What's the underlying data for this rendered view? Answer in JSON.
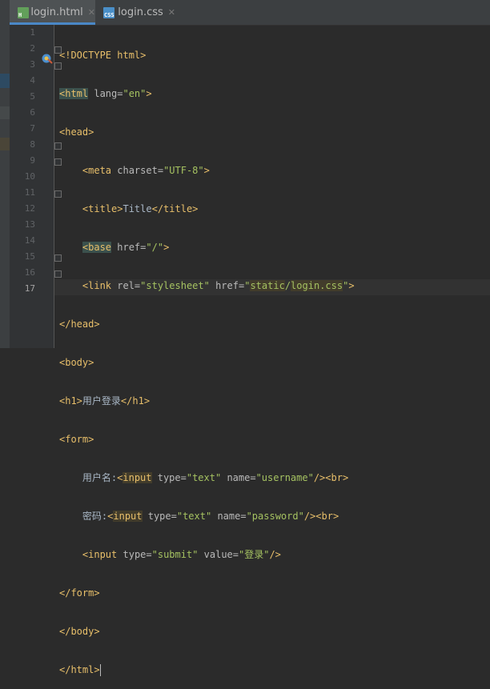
{
  "tabs": [
    {
      "label": "login.html",
      "icon": "html-file-icon",
      "icon_text": "H",
      "active": true
    },
    {
      "label": "login.css",
      "icon": "css-file-icon",
      "icon_text": "CSS",
      "active": false
    }
  ],
  "line_numbers": [
    "1",
    "2",
    "3",
    "4",
    "5",
    "6",
    "7",
    "8",
    "9",
    "10",
    "11",
    "12",
    "13",
    "14",
    "15",
    "16",
    "17"
  ],
  "current_line": "17",
  "code": {
    "l1": {
      "doctype": "<!DOCTYPE html>"
    },
    "l2": {
      "open": "<html",
      "attr": " lang=",
      "val": "\"en\"",
      "close": ">"
    },
    "l3": {
      "tag": "<head>"
    },
    "l4": {
      "open": "<meta",
      "attr": " charset=",
      "val": "\"UTF-8\"",
      "close": ">"
    },
    "l5": {
      "open": "<title>",
      "text": "Title",
      "close": "</title>"
    },
    "l6": {
      "open": "<base",
      "attr": " href=",
      "val": "\"/\"",
      "close": ">"
    },
    "l7": {
      "open": "<link",
      "attr1": " rel=",
      "val1": "\"stylesheet\"",
      "attr2": " href=",
      "q1": "\"",
      "seg1": "static",
      "slash": "/",
      "seg2": "login.css",
      "q2": "\"",
      "close": ">"
    },
    "l8": {
      "tag": "</head>"
    },
    "l9": {
      "tag": "<body>"
    },
    "l10": {
      "open": "<h1>",
      "text": "用户登录",
      "close": "</h1>"
    },
    "l11": {
      "tag": "<form>"
    },
    "l12": {
      "text": "用户名:",
      "lt": "<",
      "name": "input",
      "attr1": " type=",
      "val1": "\"text\"",
      "attr2": " name=",
      "val2": "\"username\"",
      "close": "/>",
      "br": "<br>"
    },
    "l13": {
      "text": "密码:",
      "lt": "<",
      "name": "input",
      "attr1": " type=",
      "val1": "\"text\"",
      "attr2": " name=",
      "val2": "\"password\"",
      "close": "/>",
      "br": "<br>"
    },
    "l14": {
      "open": "<input",
      "attr1": " type=",
      "val1": "\"submit\"",
      "attr2": " value=",
      "val2": "\"登录\"",
      "close": "/>"
    },
    "l15": {
      "tag": "</form>"
    },
    "l16": {
      "tag": "</body>"
    },
    "l17": {
      "tag": "</html>"
    }
  }
}
